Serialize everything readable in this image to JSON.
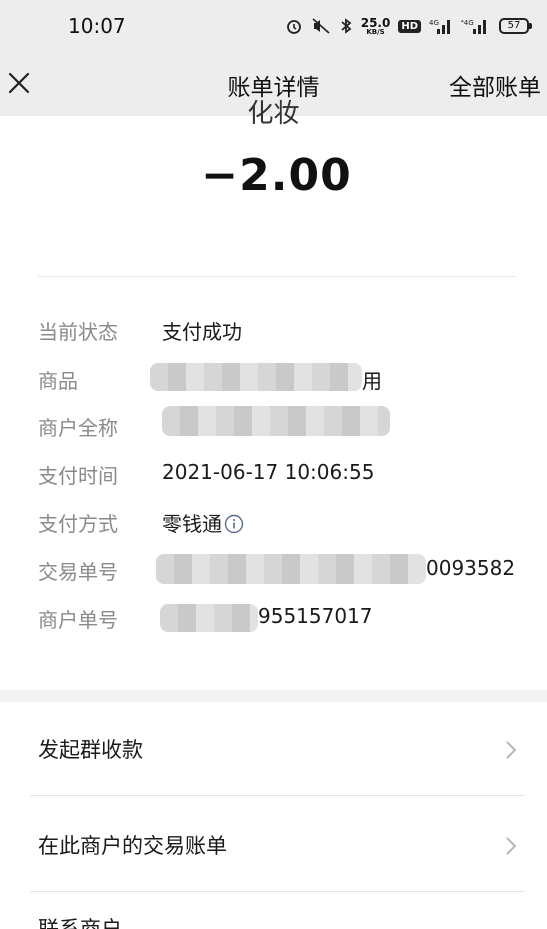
{
  "status_bar": {
    "time": "10:07",
    "net_speed_value": "25.0",
    "net_speed_unit": "KB/S",
    "hd": "HD",
    "battery": "57"
  },
  "nav": {
    "title": "账单详情",
    "right_action": "全部账单"
  },
  "header": {
    "cut_label": "化妆",
    "amount": "−2.00"
  },
  "details": [
    {
      "label": "当前状态",
      "value": "支付成功"
    },
    {
      "label": "商品",
      "value": "用"
    },
    {
      "label": "商户全称",
      "value": ""
    },
    {
      "label": "支付时间",
      "value": "2021-06-17 10:06:55"
    },
    {
      "label": "支付方式",
      "value": "零钱通"
    },
    {
      "label": "交易单号",
      "value": "0093582"
    },
    {
      "label": "商户单号",
      "value": "955157017"
    }
  ],
  "actions": [
    {
      "label": "发起群收款"
    },
    {
      "label": "在此商户的交易账单"
    },
    {
      "label": "联系商户"
    }
  ]
}
